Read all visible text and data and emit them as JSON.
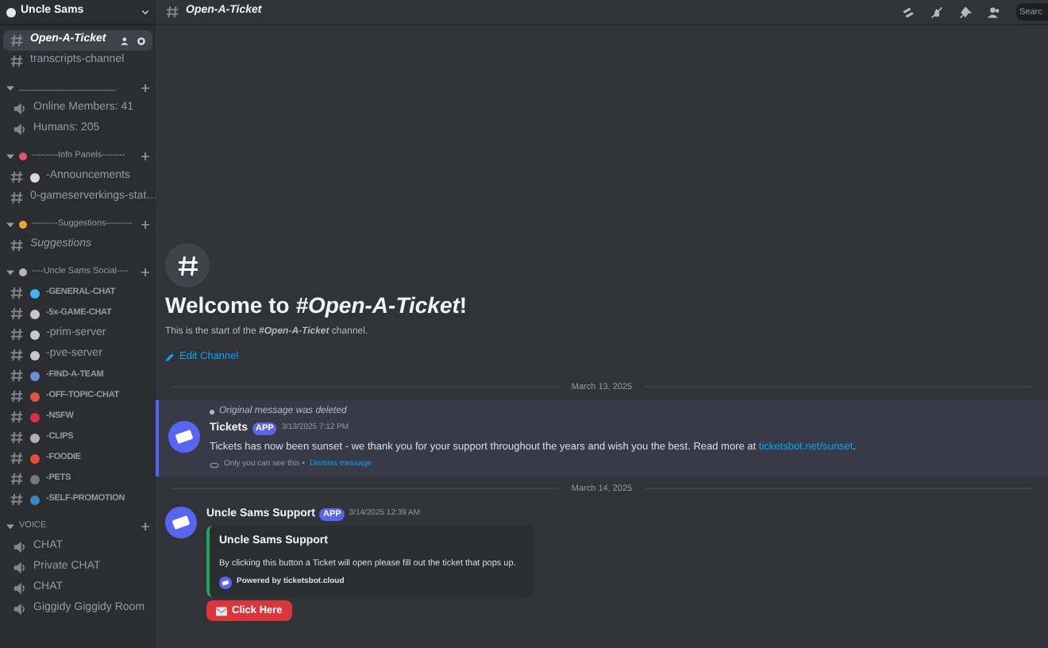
{
  "server": {
    "name": "Uncle Sams"
  },
  "sidebar": [
    {
      "kind": "channel",
      "name": "Open-A-Ticket",
      "selected": true,
      "italic": true
    },
    {
      "kind": "channel",
      "name": "transcripts-channel",
      "selected": false,
      "italic": false
    },
    {
      "kind": "category",
      "name": "____________________"
    },
    {
      "kind": "speaker",
      "name": "Online Members: 41"
    },
    {
      "kind": "speaker",
      "name": "Humans: 205"
    },
    {
      "kind": "category",
      "name": "---------Info Panels--------",
      "color": "#e0566b"
    },
    {
      "kind": "channel",
      "name": "-Announcements",
      "selected": false,
      "italic": false,
      "color": "#d9d9d9"
    },
    {
      "kind": "channel",
      "name": "0-gameserverkings-stat…",
      "selected": false,
      "italic": false
    },
    {
      "kind": "category",
      "name": "---------Suggestions---------",
      "color": "#f0a232"
    },
    {
      "kind": "channel",
      "name": "Suggestions",
      "selected": false,
      "italic": true
    },
    {
      "kind": "category",
      "name": "----Uncle Sams Social----",
      "color": "#b5b5b5"
    },
    {
      "kind": "channel",
      "name": "-GENERAL-CHAT",
      "selected": false,
      "italic": false,
      "small": true,
      "color": "#3fb5f0"
    },
    {
      "kind": "channel",
      "name": "-5x-GAME-CHAT",
      "selected": false,
      "italic": false,
      "small": true,
      "color": "#c8c8c8"
    },
    {
      "kind": "channel",
      "name": "-prim-server",
      "selected": false,
      "italic": false,
      "color": "#c8c8c8"
    },
    {
      "kind": "channel",
      "name": "-pve-server",
      "selected": false,
      "italic": false,
      "color": "#c8c8c8"
    },
    {
      "kind": "channel",
      "name": "-FIND-A-TEAM",
      "selected": false,
      "italic": false,
      "small": true,
      "color": "#6b8fe0"
    },
    {
      "kind": "channel",
      "name": "-OFF-TOPIC-CHAT",
      "selected": false,
      "italic": false,
      "small": true,
      "color": "#e0553a"
    },
    {
      "kind": "channel",
      "name": "-NSFW",
      "selected": false,
      "italic": false,
      "small": true,
      "color": "#dd2e44"
    },
    {
      "kind": "channel",
      "name": "-CLIPS",
      "selected": false,
      "italic": false,
      "small": true,
      "color": "#b0b0b0"
    },
    {
      "kind": "channel",
      "name": "-FOODIE",
      "selected": false,
      "italic": false,
      "small": true,
      "color": "#e84b3c"
    },
    {
      "kind": "channel",
      "name": "-PETS",
      "selected": false,
      "italic": false,
      "small": true,
      "color": "#777777"
    },
    {
      "kind": "channel",
      "name": "-SELF-PROMOTION",
      "selected": false,
      "italic": false,
      "small": true,
      "color": "#3b88c3"
    },
    {
      "kind": "category",
      "name": "VOICE"
    },
    {
      "kind": "speaker",
      "name": "CHAT"
    },
    {
      "kind": "speaker",
      "name": "Private CHAT"
    },
    {
      "kind": "speaker",
      "name": "CHAT"
    },
    {
      "kind": "speaker",
      "name": "Giggidy Giggidy Room"
    }
  ],
  "header": {
    "channel": "Open-A-Ticket",
    "search": {
      "placeholder": "Searc"
    }
  },
  "welcome": {
    "title_prefix": "Welcome to ",
    "title_channel": "#Open-A-Ticket",
    "title_suffix": "!",
    "intro_prefix": "This is the start of the ",
    "intro_channel": "#Open-A-Ticket",
    "intro_suffix": " channel.",
    "edit": "Edit Channel"
  },
  "messages": [
    {
      "kind": "divider",
      "date": "March 13, 2025"
    },
    {
      "kind": "message",
      "ephemeral": true,
      "reply": "Original message was deleted",
      "author": "Tickets",
      "badge": "APP",
      "time": "3/13/2025 7:12 PM",
      "text": "Tickets has now been sunset - we thank you for your support throughout the years and wish you the best. Read more at ",
      "link": "ticketsbot.net/sunset",
      "text_end": ".",
      "notice": "Only you can see this •",
      "dismiss": "Dismiss message"
    },
    {
      "kind": "divider",
      "date": "March 14, 2025"
    },
    {
      "kind": "message",
      "author": "Uncle Sams Support",
      "badge": "APP",
      "time": "3/14/2025 12:39 AM",
      "embed": {
        "title": "Uncle Sams Support",
        "description": "By clicking this button a Ticket will open please fill out the ticket that pops up.",
        "footer": "Powered by ticketsbot.cloud",
        "color": "#23a55a"
      },
      "button": "Click Here"
    }
  ]
}
